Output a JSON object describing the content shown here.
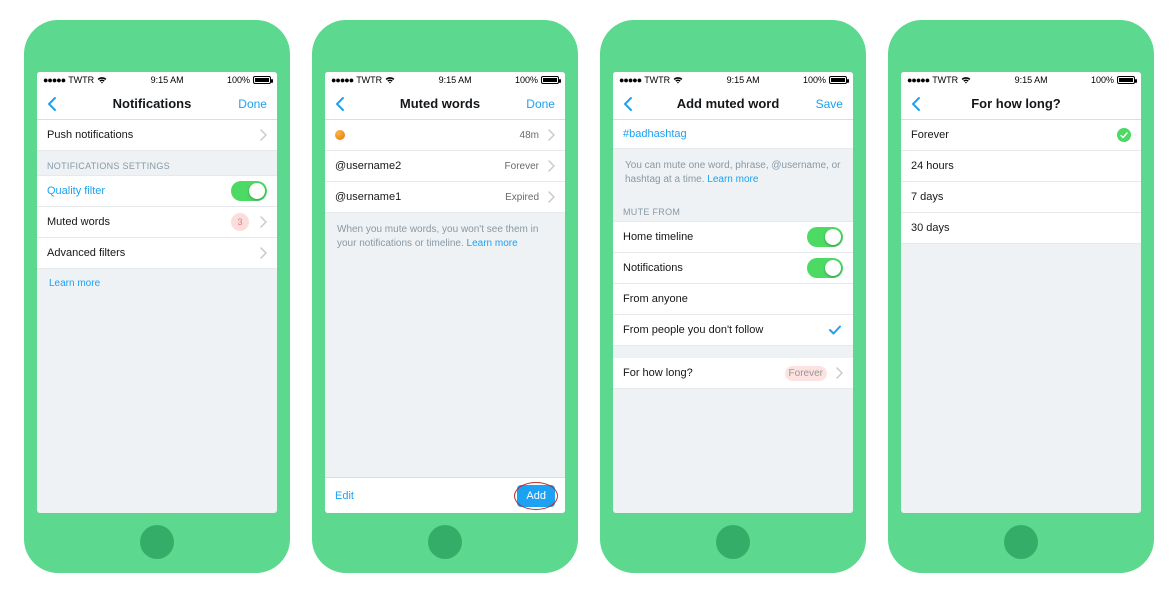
{
  "status": {
    "carrier": "TWTR",
    "time": "9:15 AM",
    "battery": "100%"
  },
  "screens": [
    {
      "title": "Notifications",
      "action": "Done",
      "push_label": "Push notifications",
      "section": "NOTIFICATIONS SETTINGS",
      "quality_filter": "Quality filter",
      "muted_words": "Muted words",
      "muted_badge": "3",
      "advanced_filters": "Advanced filters",
      "learn_more": "Learn more"
    },
    {
      "title": "Muted words",
      "action": "Done",
      "items": [
        {
          "label_emoji": true,
          "value": "48m"
        },
        {
          "label": "@username2",
          "value": "Forever"
        },
        {
          "label": "@username1",
          "value": "Expired"
        }
      ],
      "help": "When you mute words, you won't see them in your notifications or timeline.",
      "learn_more": "Learn more",
      "edit": "Edit",
      "add": "Add"
    },
    {
      "title": "Add muted word",
      "action": "Save",
      "input": "#badhashtag",
      "help": "You can mute one word, phrase, @username, or hashtag at a time.",
      "learn_more": "Learn more",
      "mute_from": "MUTE FROM",
      "home_timeline": "Home timeline",
      "notifications": "Notifications",
      "from_anyone": "From anyone",
      "from_nonfollow": "From people you don't follow",
      "duration_label": "For how long?",
      "duration_value": "Forever"
    },
    {
      "title": "For how long?",
      "options": [
        {
          "label": "Forever",
          "selected": true
        },
        {
          "label": "24 hours",
          "selected": false
        },
        {
          "label": "7 days",
          "selected": false
        },
        {
          "label": "30 days",
          "selected": false
        }
      ]
    }
  ]
}
